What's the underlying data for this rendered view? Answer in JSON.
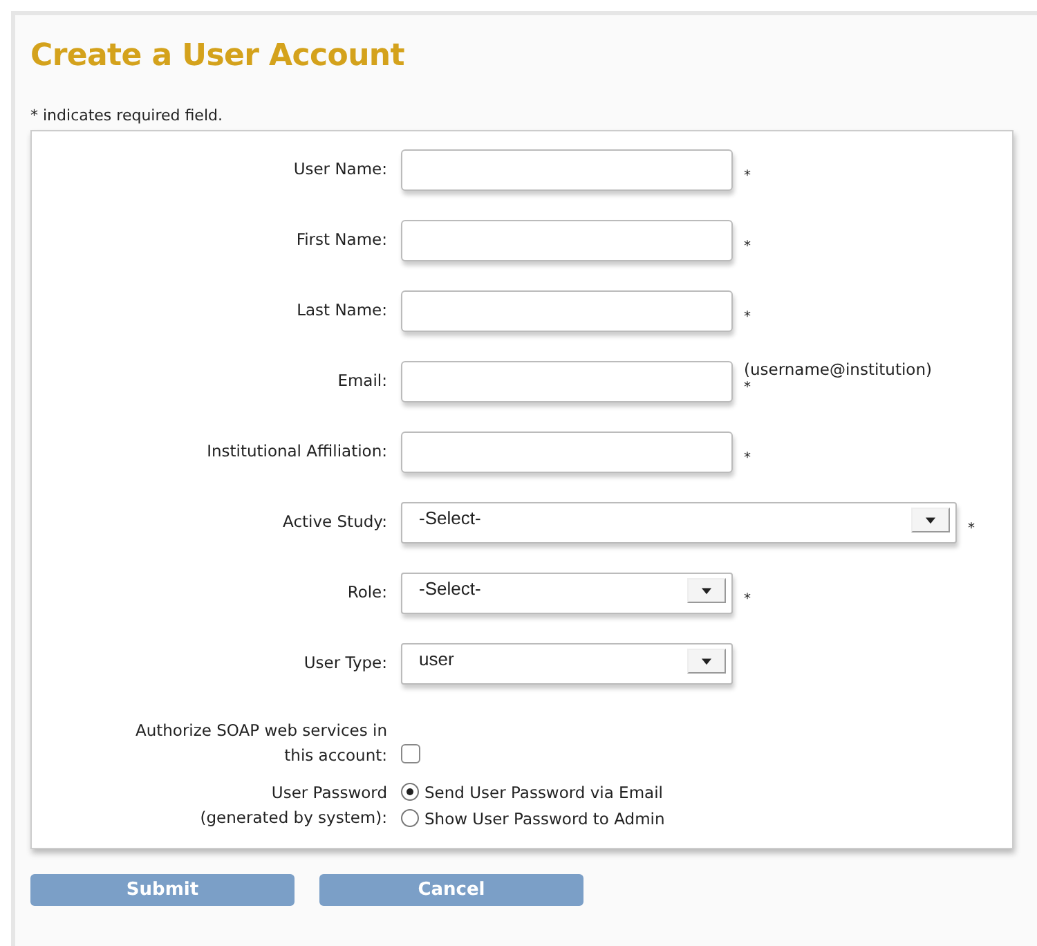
{
  "title": "Create a User Account",
  "required_note": "* indicates required field.",
  "fields": [
    {
      "kind": "text",
      "label": "User Name:",
      "mark": "*"
    },
    {
      "kind": "text",
      "label": "First Name:",
      "mark": "*"
    },
    {
      "kind": "text",
      "label": "Last Name:",
      "mark": "*"
    },
    {
      "kind": "text",
      "label": "Email:",
      "mark": "*",
      "hint": "(username@institution)"
    },
    {
      "kind": "text",
      "label": "Institutional Affiliation:",
      "mark": "*"
    },
    {
      "kind": "select",
      "label": "Active Study:",
      "value": "-Select-",
      "wide": true,
      "mark": "*"
    },
    {
      "kind": "select",
      "label": "Role:",
      "value": "-Select-",
      "wide": false,
      "mark": "*"
    },
    {
      "kind": "select",
      "label": "User Type:",
      "value": "user",
      "wide": false
    },
    {
      "kind": "checkbox",
      "label_lines": [
        "Authorize SOAP web services in",
        "this account:"
      ],
      "checked": false
    },
    {
      "kind": "radio",
      "label_lines": [
        "User Password",
        "(generated by system):"
      ],
      "options": [
        {
          "label": "Send User Password via Email",
          "selected": true
        },
        {
          "label": "Show User Password to Admin",
          "selected": false
        }
      ]
    }
  ],
  "buttons": [
    "Submit",
    "Cancel"
  ]
}
